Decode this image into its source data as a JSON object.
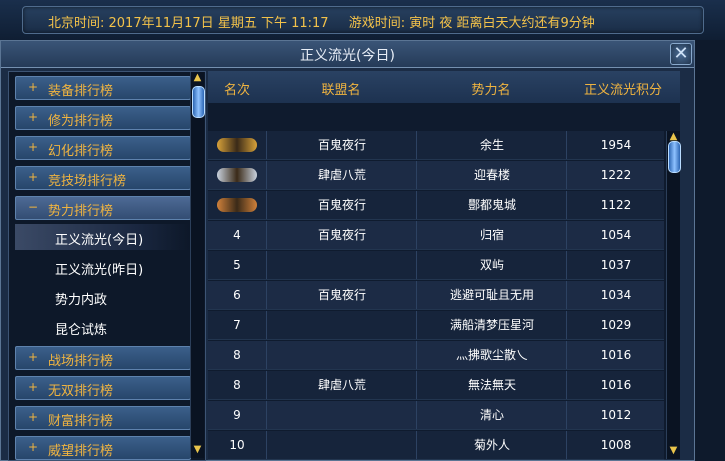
{
  "info_bar": {
    "beijing_time": "北京时间: 2017年11月17日 星期五 下午 11:17",
    "game_time": "游戏时间: 寅时 夜 距离白天大约还有9分钟"
  },
  "window": {
    "title": "正义流光(今日)",
    "close_icon": "close-x-icon"
  },
  "sidebar": {
    "items": [
      {
        "sign": "+",
        "label": "装备排行榜"
      },
      {
        "sign": "+",
        "label": "修为排行榜"
      },
      {
        "sign": "+",
        "label": "幻化排行榜"
      },
      {
        "sign": "+",
        "label": "竞技场排行榜"
      },
      {
        "sign": "−",
        "label": "势力排行榜"
      }
    ],
    "sub_items": [
      "正义流光(今日)",
      "正义流光(昨日)",
      "势力内政",
      "昆仑试炼"
    ],
    "more_items": [
      {
        "sign": "+",
        "label": "战场排行榜"
      },
      {
        "sign": "+",
        "label": "无双排行榜"
      },
      {
        "sign": "+",
        "label": "财富排行榜"
      },
      {
        "sign": "+",
        "label": "威望排行榜"
      }
    ]
  },
  "table": {
    "headers": [
      "名次",
      "联盟名",
      "势力名",
      "正义流光积分"
    ],
    "rows": [
      {
        "rank": "",
        "medal": "gold",
        "league": "百鬼夜行",
        "faction": "余生",
        "score": "1954"
      },
      {
        "rank": "",
        "medal": "silver",
        "league": "肆虐八荒",
        "faction": "迎春楼",
        "score": "1222"
      },
      {
        "rank": "",
        "medal": "bronze",
        "league": "百鬼夜行",
        "faction": "酆都鬼城",
        "score": "1122"
      },
      {
        "rank": "4",
        "medal": "",
        "league": "百鬼夜行",
        "faction": "归宿",
        "score": "1054"
      },
      {
        "rank": "5",
        "medal": "",
        "league": "",
        "faction": "双屿",
        "score": "1037"
      },
      {
        "rank": "6",
        "medal": "",
        "league": "百鬼夜行",
        "faction": "逃避可耻且无用",
        "score": "1034"
      },
      {
        "rank": "7",
        "medal": "",
        "league": "",
        "faction": "满船清梦压星河",
        "score": "1029"
      },
      {
        "rank": "8",
        "medal": "",
        "league": "",
        "faction": "灬拂歌尘散乀",
        "score": "1016"
      },
      {
        "rank": "8",
        "medal": "",
        "league": "肆虐八荒",
        "faction": "無法無天",
        "score": "1016"
      },
      {
        "rank": "9",
        "medal": "",
        "league": "",
        "faction": "清心",
        "score": "1012"
      },
      {
        "rank": "10",
        "medal": "",
        "league": "",
        "faction": "菊外人",
        "score": "1008"
      }
    ]
  },
  "colors": {
    "gold": "#d8a23a",
    "silver": "#c9d2de",
    "bronze": "#d0813b"
  }
}
